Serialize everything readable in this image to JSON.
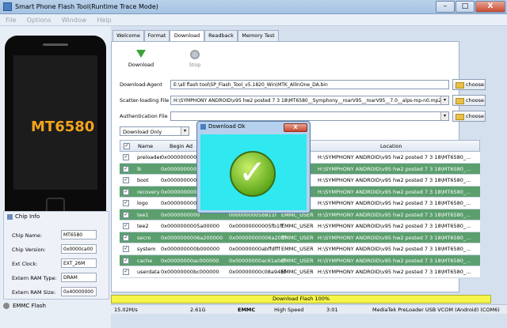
{
  "window": {
    "title": "Smart Phone Flash Tool(Runtime Trace Mode)",
    "min": "–",
    "max": "□",
    "close": "X"
  },
  "menu": [
    "File",
    "Options",
    "Window",
    "Help"
  ],
  "phone": {
    "chip_text": "MT6580"
  },
  "chip_info": {
    "header": "Chip Info",
    "rows": [
      {
        "label": "Chip Name:",
        "value": "MT6580"
      },
      {
        "label": "Chip Version:",
        "value": "0x0000ca00"
      },
      {
        "label": "Ext Clock:",
        "value": "EXT_26M"
      },
      {
        "label": "Extern RAM Type:",
        "value": "DRAM"
      },
      {
        "label": "Extern RAM Size:",
        "value": "0x40000000"
      }
    ],
    "storage": "EMMC Flash"
  },
  "tabs": [
    "Welcome",
    "Format",
    "Download",
    "Readback",
    "Memory Test"
  ],
  "toolbar": {
    "download": "Download",
    "stop": "Stop"
  },
  "fields": {
    "download_agent": {
      "label": "Download-Agent",
      "value": "E:\\all flash tool\\SP_Flash_Tool_v5.1820_Win\\MTK_AllInOne_DA.bin"
    },
    "scatter": {
      "label": "Scatter-loading File",
      "value": "H:\\SYMPHONY ANDROID\\v95 hw2 posted 7 3 18\\MT6580__Symphony__roarV95__roarV95__7.0__alps-mp-n0.mp2-"
    },
    "auth": {
      "label": "Authentication File",
      "value": ""
    },
    "choose": "choose",
    "mode": "Download Only"
  },
  "table": {
    "headers": [
      "Name",
      "Begin Ad",
      "",
      "",
      "Location"
    ],
    "rows": [
      {
        "name": "preloader",
        "begin": "0x0000000000",
        "end": "",
        "region": "",
        "loc": "H:\\SYMPHONY ANDROID\\v95 hw2 posted 7 3 18\\MT6580_...",
        "green": false
      },
      {
        "name": "lk",
        "begin": "0x0000000000",
        "end": "",
        "region": "",
        "loc": "H:\\SYMPHONY ANDROID\\v95 hw2 posted 7 3 18\\MT6580_...",
        "green": true
      },
      {
        "name": "boot",
        "begin": "0x0000000000",
        "end": "",
        "region": "",
        "loc": "H:\\SYMPHONY ANDROID\\v95 hw2 posted 7 3 18\\MT6580_...",
        "green": false
      },
      {
        "name": "recovery",
        "begin": "0x0000000000",
        "end": "",
        "region": "",
        "loc": "H:\\SYMPHONY ANDROID\\v95 hw2 posted 7 3 18\\MT6580_...",
        "green": true
      },
      {
        "name": "logo",
        "begin": "0x0000000000",
        "end": "",
        "region": "",
        "loc": "H:\\SYMPHONY ANDROID\\v95 hw2 posted 7 3 18\\MT6580_...",
        "green": false
      },
      {
        "name": "tee1",
        "begin": "0x0000000000",
        "end": "0000000005b811f",
        "region": "EMMC_USER",
        "loc": "H:\\SYMPHONY ANDROID\\v95 hw2 posted 7 3 18\\MT6580_...",
        "green": true
      },
      {
        "name": "tee2",
        "begin": "0x0000000005a00000",
        "end": "0x00000000005fb1ff",
        "region": "EMMC_USER",
        "loc": "H:\\SYMPHONY ANDROID\\v95 hw2 posted 7 3 18\\MT6580_...",
        "green": false
      },
      {
        "name": "secro",
        "begin": "0x0000000006a200000",
        "end": "0x00000000006a20fff",
        "region": "EMMC_USER",
        "loc": "H:\\SYMPHONY ANDROID\\v95 hw2 posted 7 3 18\\MT6580_...",
        "green": true
      },
      {
        "name": "system",
        "begin": "0x000000000b000000",
        "end": "0x00000000abffdfff",
        "region": "EMMC_USER",
        "loc": "H:\\SYMPHONY ANDROID\\v95 hw2 posted 7 3 18\\MT6580_...",
        "green": false
      },
      {
        "name": "cache",
        "begin": "0x00000000ac000000",
        "end": "0x00000000ac61a0cf",
        "region": "EMMC_USER",
        "loc": "H:\\SYMPHONY ANDROID\\v95 hw2 posted 7 3 18\\MT6580_...",
        "green": true
      },
      {
        "name": "userdata",
        "begin": "0x00000000bc000000",
        "end": "0x00000000c08a94bf",
        "region": "EMMC_USER",
        "loc": "H:\\SYMPHONY ANDROID\\v95 hw2 posted 7 3 18\\MT6580_...",
        "green": false
      }
    ]
  },
  "progress": {
    "text": "Download Flash 100%",
    "fraction": 1.0
  },
  "statusbar": {
    "speed": "15.02M/s",
    "size": "2.61G",
    "storage": "EMMC",
    "mode": "High Speed",
    "time": "3:01",
    "port": "MediaTek PreLoader USB VCOM (Android) (COM6)"
  },
  "dialog": {
    "title": "Download Ok",
    "close": "X"
  }
}
